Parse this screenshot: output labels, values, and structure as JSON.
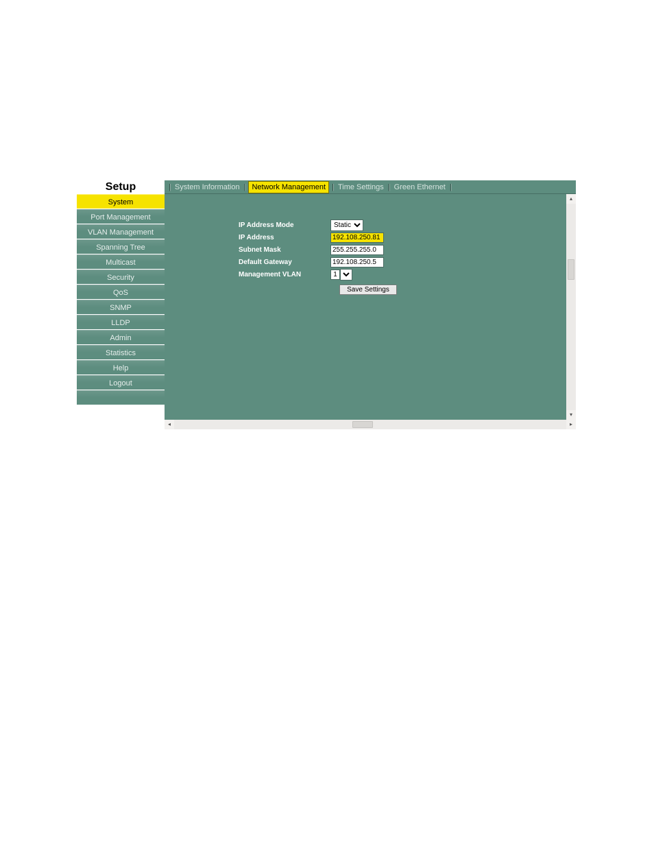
{
  "header": {
    "title": "Setup"
  },
  "tabs": {
    "items": [
      {
        "label": "System Information"
      },
      {
        "label": "Network Management"
      },
      {
        "label": "Time Settings"
      },
      {
        "label": "Green Ethernet"
      }
    ],
    "active_index": 1
  },
  "sidebar": {
    "items": [
      "System",
      "Port Management",
      "VLAN Management",
      "Spanning Tree",
      "Multicast",
      "Security",
      "QoS",
      "SNMP",
      "LLDP",
      "Admin",
      "Statistics",
      "Help",
      "Logout"
    ],
    "active_index": 0
  },
  "form": {
    "ip_mode_label": "IP Address Mode",
    "ip_mode_value": "Static",
    "ip_addr_label": "IP Address",
    "ip_addr_value": "192.108.250.81",
    "subnet_label": "Subnet Mask",
    "subnet_value": "255.255.255.0",
    "gateway_label": "Default Gateway",
    "gateway_value": "192.108.250.5",
    "vlan_label": "Management VLAN",
    "vlan_value": "1",
    "save_label": "Save Settings"
  }
}
